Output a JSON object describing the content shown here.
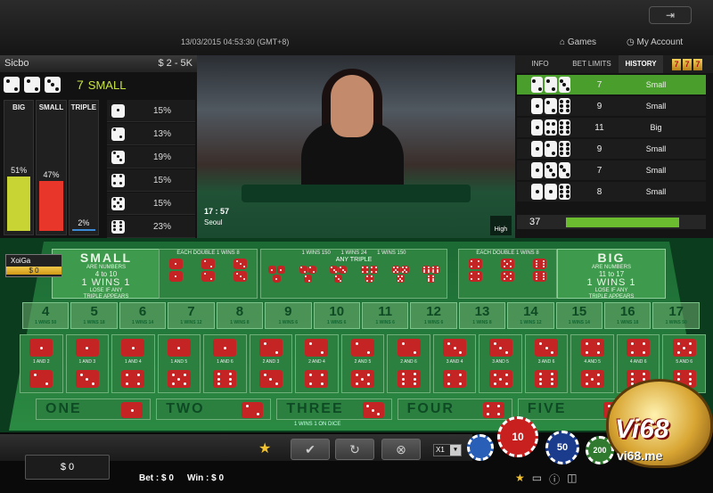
{
  "header": {
    "exit_icon": "exit-icon",
    "datetime": "13/03/2015 04:53:30 (GMT+8)",
    "games": "Games",
    "account": "My Account"
  },
  "left": {
    "game": "Sicbo",
    "limits": "$ 2 - 5K",
    "last_result": {
      "dice": [
        2,
        2,
        3
      ],
      "total": "7",
      "label": "SMALL"
    },
    "stats": [
      {
        "label": "BIG",
        "pct": "51%",
        "value": 51,
        "color": "#c8d334"
      },
      {
        "label": "SMALL",
        "pct": "47%",
        "value": 47,
        "color": "#e8362a"
      },
      {
        "label": "TRIPLE",
        "pct": "2%",
        "value": 2,
        "color": "#3b8bd6"
      }
    ],
    "frequency": [
      {
        "face": 1,
        "pct": "15%"
      },
      {
        "face": 2,
        "pct": "13%"
      },
      {
        "face": 3,
        "pct": "19%"
      },
      {
        "face": 4,
        "pct": "15%"
      },
      {
        "face": 5,
        "pct": "15%"
      },
      {
        "face": 6,
        "pct": "23%"
      }
    ]
  },
  "video": {
    "time": "17 : 57",
    "city": "Seoul",
    "quality": "High"
  },
  "right": {
    "tabs": [
      "INFO",
      "BET LIMITS",
      "HISTORY"
    ],
    "history": [
      {
        "dice": [
          2,
          2,
          3
        ],
        "total": "7",
        "result": "Small"
      },
      {
        "dice": [
          1,
          2,
          6
        ],
        "total": "9",
        "result": "Small"
      },
      {
        "dice": [
          1,
          4,
          6
        ],
        "total": "11",
        "result": "Big"
      },
      {
        "dice": [
          1,
          2,
          6
        ],
        "total": "9",
        "result": "Small"
      },
      {
        "dice": [
          1,
          3,
          3
        ],
        "total": "7",
        "result": "Small"
      },
      {
        "dice": [
          1,
          1,
          6
        ],
        "total": "8",
        "result": "Small"
      }
    ],
    "round": "37",
    "round_progress": 0.82
  },
  "table": {
    "player": {
      "name": "XoiGa",
      "value": "$ 0"
    },
    "small": {
      "title": "SMALL",
      "l1": "ARE NUMBERS",
      "l2": "4 to 10",
      "wins": "1 WINS 1",
      "l3": "LOSE IF ANY",
      "l4": "TRIPLE APPEARS"
    },
    "big": {
      "title": "BIG",
      "l1": "ARE NUMBERS",
      "l2": "11 to 17",
      "wins": "1 WINS 1",
      "l3": "LOSE IF ANY",
      "l4": "TRIPLE APPEARS"
    },
    "doubles_a": "EACH DOUBLE 1 WINS 8",
    "doubles_b": "EACH DOUBLE 1 WINS 8",
    "triples_a": "1 WINS 150",
    "any_triple": "ANY TRIPLE",
    "any_triple_win": "1 WINS 24",
    "triples_b": "1 WINS 150",
    "totals": [
      {
        "n": "4",
        "w": "1 WINS 50"
      },
      {
        "n": "5",
        "w": "1 WINS 18"
      },
      {
        "n": "6",
        "w": "1 WINS 14"
      },
      {
        "n": "7",
        "w": "1 WINS 12"
      },
      {
        "n": "8",
        "w": "1 WINS 8"
      },
      {
        "n": "9",
        "w": "1 WINS 6"
      },
      {
        "n": "10",
        "w": "1 WINS 6"
      },
      {
        "n": "11",
        "w": "1 WINS 6"
      },
      {
        "n": "12",
        "w": "1 WINS 6"
      },
      {
        "n": "13",
        "w": "1 WINS 8"
      },
      {
        "n": "14",
        "w": "1 WINS 12"
      },
      {
        "n": "15",
        "w": "1 WINS 14"
      },
      {
        "n": "16",
        "w": "1 WINS 18"
      },
      {
        "n": "17",
        "w": "1 WINS 50"
      }
    ],
    "combos": [
      [
        "1",
        "2"
      ],
      [
        "1",
        "3"
      ],
      [
        "1",
        "4"
      ],
      [
        "1",
        "5"
      ],
      [
        "1",
        "6"
      ],
      [
        "2",
        "3"
      ],
      [
        "2",
        "4"
      ],
      [
        "2",
        "5"
      ],
      [
        "2",
        "6"
      ],
      [
        "3",
        "4"
      ],
      [
        "3",
        "5"
      ],
      [
        "3",
        "6"
      ],
      [
        "4",
        "5"
      ],
      [
        "4",
        "6"
      ],
      [
        "5",
        "6"
      ]
    ],
    "combo_sep": "AND",
    "singles": [
      {
        "label": "ONE",
        "face": 1
      },
      {
        "label": "TWO",
        "face": 2
      },
      {
        "label": "THREE",
        "face": 3
      },
      {
        "label": "FOUR",
        "face": 4
      },
      {
        "label": "FIVE",
        "face": 5
      }
    ],
    "singles_note": "1 WINS 1 ON DICE"
  },
  "bottom": {
    "balance": "$ 0",
    "bet": "Bet : $ 0",
    "win": "Win : $ 0",
    "multiplier": "X1",
    "chips": [
      "10",
      "50",
      "200"
    ],
    "confirm_icon": "check-icon",
    "repeat_icon": "repeat-icon",
    "clear_icon": "clear-icon"
  },
  "logo": {
    "word": "Vi68",
    "url": "vi68.me"
  }
}
